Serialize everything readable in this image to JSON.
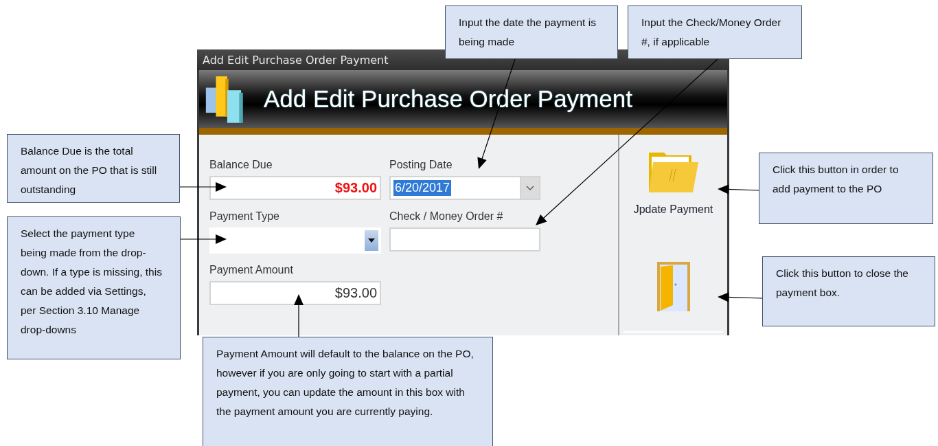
{
  "window": {
    "title": "Add Edit Purchase Order Payment"
  },
  "header": {
    "title": "Add Edit Purchase Order Payment"
  },
  "fields": [
    {
      "kind": "due-amount",
      "label": "Balance Due",
      "value": "$93.00"
    },
    {
      "kind": "date",
      "label": "Posting Date",
      "value": "6/20/2017",
      "text_selected": true
    },
    {
      "kind": "dropdown",
      "label": "Payment Type"
    },
    {
      "kind": "text",
      "label": "Check / Money Order #"
    },
    {
      "kind": "text",
      "label": "Payment Amount",
      "value": "$93.00"
    }
  ],
  "side_buttons": [
    {
      "kind": "folder",
      "label": "Jpdate Payment"
    },
    {
      "kind": "door"
    }
  ],
  "callouts": [
    "Input the date the payment is being made",
    "Input the Check/Money Order #, if applicable",
    "Balance Due is the total amount on the PO that is still outstanding",
    "Select the payment type being made from the drop-down. If a type is missing, this can be added via Settings, per Section 3.10 Manage drop-downs",
    "Payment Amount will default to the balance on the PO, however if you are only going to start with a partial payment, you can update the amount in this box with the payment amount you are currently paying.",
    "Click this button in order to add payment to the PO",
    "Click this button to close the payment box."
  ]
}
